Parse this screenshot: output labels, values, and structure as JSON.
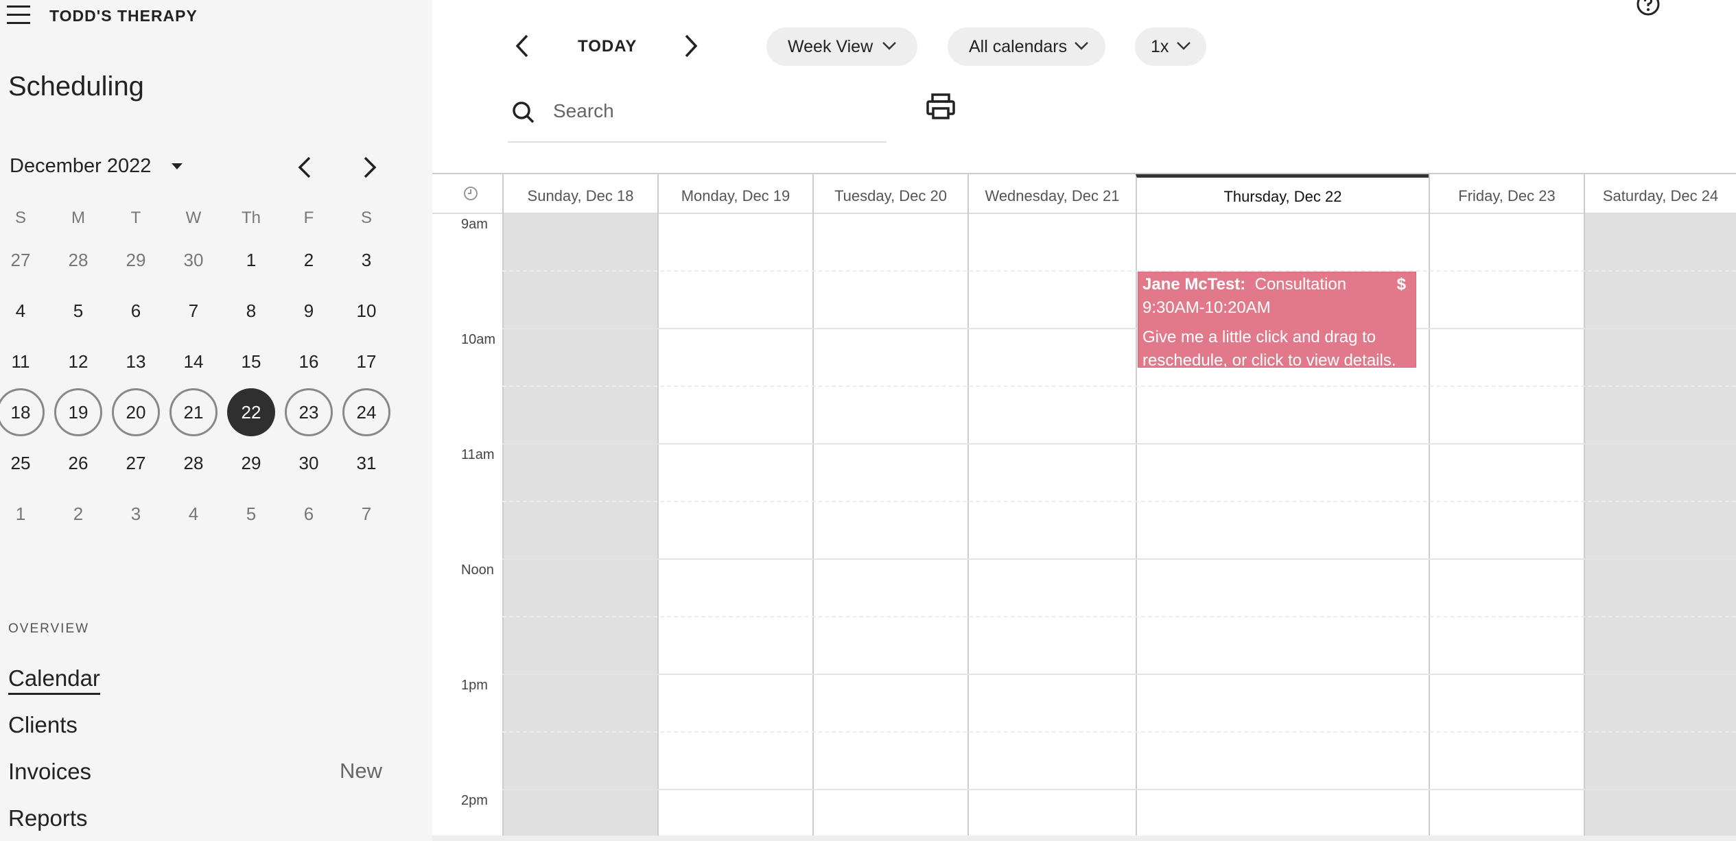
{
  "app": {
    "brand": "TODD'S THERAPY",
    "section_title": "Scheduling"
  },
  "mini_calendar": {
    "month_label": "December 2022",
    "weekday_headers": [
      "S",
      "M",
      "T",
      "W",
      "Th",
      "F",
      "S"
    ],
    "weeks": [
      [
        "27",
        "28",
        "29",
        "30",
        "1",
        "2",
        "3"
      ],
      [
        "4",
        "5",
        "6",
        "7",
        "8",
        "9",
        "10"
      ],
      [
        "11",
        "12",
        "13",
        "14",
        "15",
        "16",
        "17"
      ],
      [
        "18",
        "19",
        "20",
        "21",
        "22",
        "23",
        "24"
      ],
      [
        "25",
        "26",
        "27",
        "28",
        "29",
        "30",
        "31"
      ],
      [
        "1",
        "2",
        "3",
        "4",
        "5",
        "6",
        "7"
      ]
    ],
    "selected_week_index": 3,
    "today_day": "22"
  },
  "sidebar": {
    "overview_label": "OVERVIEW",
    "nav": {
      "calendar": "Calendar",
      "clients": "Clients",
      "invoices": "Invoices",
      "reports": "Reports"
    },
    "invoices_badge": "New"
  },
  "toolbar": {
    "today_label": "TODAY",
    "view_select": "Week View",
    "calendars_select": "All calendars",
    "zoom_select": "1x"
  },
  "search": {
    "placeholder": "Search",
    "value": ""
  },
  "week": {
    "days": [
      "Sunday, Dec 18",
      "Monday, Dec 19",
      "Tuesday, Dec 20",
      "Wednesday, Dec 21",
      "Thursday, Dec 22",
      "Friday, Dec 23",
      "Saturday, Dec 24"
    ],
    "current_day_index": 4,
    "time_labels": [
      "9am",
      "10am",
      "11am",
      "Noon",
      "1pm",
      "2pm"
    ]
  },
  "event": {
    "client": "Jane McTest:",
    "type": "Consultation",
    "time": "9:30AM-10:20AM",
    "description": "Give me a little click and drag to reschedule, or click to view details.",
    "price_marker": "$",
    "color": "#e2798a"
  },
  "colors": {
    "weekend_bg": "#e0e0e0",
    "today_circle": "#2f2f2f",
    "sidebar_bg": "#f5f5f5"
  }
}
